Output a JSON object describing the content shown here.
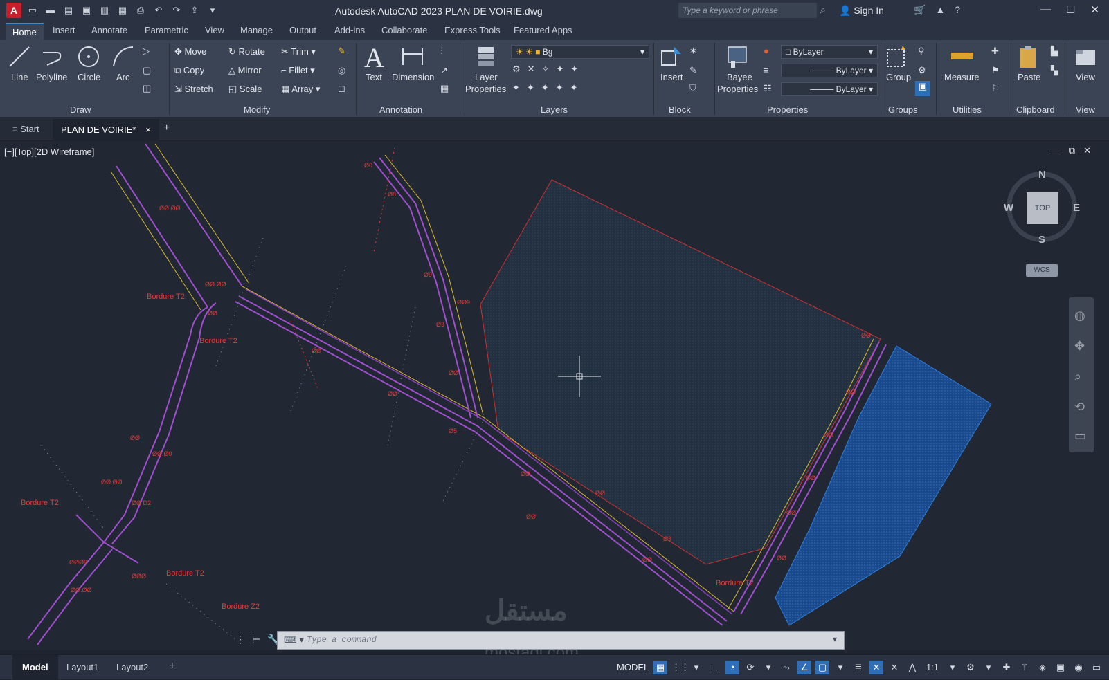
{
  "app": {
    "logo": "A",
    "title": "Autodesk AutoCAD 2023    PLAN DE VOIRIE.dwg",
    "search_placeholder": "Type a keyword or phrase",
    "sign_in": "Sign In"
  },
  "tabs": [
    "Home",
    "Insert",
    "Annotate",
    "Parametric",
    "View",
    "Manage",
    "Output",
    "Add-ins",
    "Collaborate",
    "Express Tools",
    "Featured Apps"
  ],
  "ribbon": {
    "draw": {
      "line": "Line",
      "polyline": "Polyline",
      "circle": "Circle",
      "arc": "Arc",
      "title": "Draw"
    },
    "modify": {
      "move": "Move",
      "rotate": "Rotate",
      "trim": "Trim",
      "copy": "Copy",
      "mirror": "Mirror",
      "fillet": "Fillet",
      "stretch": "Stretch",
      "scale": "Scale",
      "array": "Array",
      "title": "Modify"
    },
    "annotation": {
      "text": "Text",
      "dimension": "Dimension",
      "title": "Annotation"
    },
    "layers": {
      "layer_properties_1": "Layer",
      "layer_properties_2": "Properties",
      "current_layer": "Bყ",
      "title": "Layers"
    },
    "block": {
      "insert": "Insert",
      "title": "Block"
    },
    "properties": {
      "match_1": "Bayee",
      "match_2": "Properties",
      "color": "ByLayer",
      "linetype": "ByLayer",
      "lineweight": "ByLayer",
      "title": "Properties"
    },
    "groups": {
      "group": "Group",
      "title": "Groups"
    },
    "utilities": {
      "measure": "Measure",
      "title": "Utilities"
    },
    "clipboard": {
      "paste": "Paste",
      "title": "Clipboard"
    },
    "view": {
      "view": "View",
      "title": "View"
    }
  },
  "file_tabs": {
    "start": "Start",
    "current": "PLAN DE VOIRIE*",
    "close": "×",
    "add": "+"
  },
  "viewport": {
    "label": "[−][Top][2D Wireframe]",
    "viewcube": {
      "north": "N",
      "south": "S",
      "east": "E",
      "west": "W",
      "face": "TOP",
      "wcs": "WCS"
    },
    "annotations": [
      "Bordure T2",
      "Bordure T2",
      "Bordure T2",
      "Bordure T2",
      "Bordure T2",
      "Bordure Z2"
    ]
  },
  "command": {
    "placeholder": "Type a command"
  },
  "layout_tabs": [
    "Model",
    "Layout1",
    "Layout2"
  ],
  "status": {
    "model": "MODEL",
    "scale": "1:1"
  },
  "watermark": {
    "brand": "مستقل",
    "site": "mostaql.com"
  },
  "colors": {
    "road": "#a14fd0",
    "annotation": "#e23a3a",
    "edge": "#d9b92e",
    "hatch": "#1e4f8a",
    "zone": "#2c3e52"
  }
}
